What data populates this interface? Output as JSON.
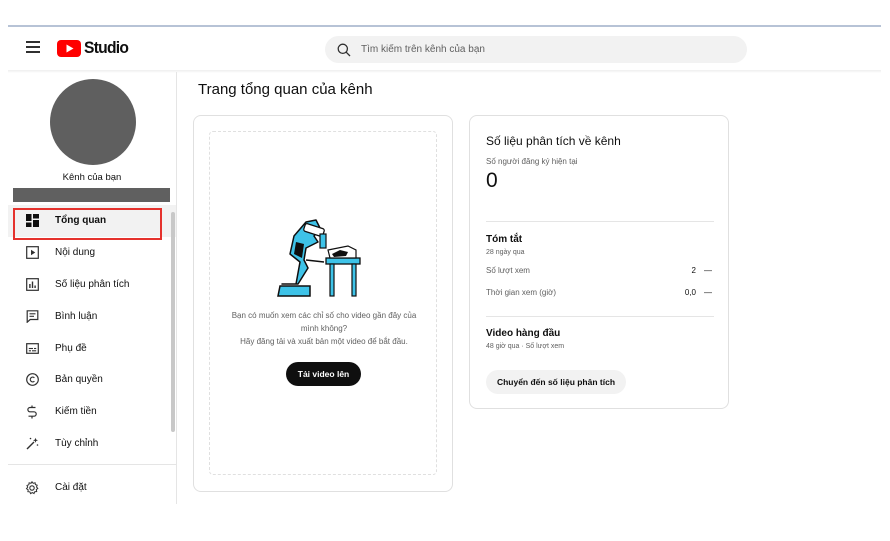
{
  "app": {
    "name": "Studio",
    "brand_color": "#ff0000"
  },
  "search": {
    "placeholder": "Tìm kiếm trên kênh của bạn",
    "icon": "search-icon"
  },
  "channel": {
    "label": "Kênh của bạn"
  },
  "sidebar": {
    "items": [
      {
        "label": "Tổng quan",
        "icon": "dashboard-icon",
        "active": true
      },
      {
        "label": "Nội dung",
        "icon": "content-icon"
      },
      {
        "label": "Số liệu phân tích",
        "icon": "analytics-icon"
      },
      {
        "label": "Bình luận",
        "icon": "comments-icon"
      },
      {
        "label": "Phụ đề",
        "icon": "subtitles-icon"
      },
      {
        "label": "Bản quyền",
        "icon": "copyright-icon"
      },
      {
        "label": "Kiếm tiền",
        "icon": "monetization-icon"
      },
      {
        "label": "Tùy chỉnh",
        "icon": "customization-icon"
      }
    ],
    "settings": {
      "label": "Cài đặt",
      "icon": "gear-icon"
    }
  },
  "page": {
    "title": "Trang tổng quan của kênh"
  },
  "upload_card": {
    "prompt_line1": "Bạn có muốn xem các chỉ số cho video gần đây của",
    "prompt_line2": "mình không?",
    "prompt_line3": "Hãy đăng tải và xuất bản một video để bắt đầu.",
    "button": "Tải video lên"
  },
  "analytics_card": {
    "title": "Số liệu phân tích về kênh",
    "subscribers_label": "Số người đăng ký hiện tại",
    "subscribers_value": "0",
    "summary_title": "Tóm tắt",
    "summary_period": "28 ngày qua",
    "metrics": [
      {
        "label": "Số lượt xem",
        "value": "2",
        "trend": "—"
      },
      {
        "label": "Thời gian xem (giờ)",
        "value": "0,0",
        "trend": "—"
      }
    ],
    "top_videos_title": "Video hàng đầu",
    "top_videos_sub": "48 giờ qua · Số lượt xem",
    "button": "Chuyển đến số liệu phân tích"
  },
  "colors": {
    "active_outline": "#e5322d",
    "avatar": "#5f5f5f",
    "illustration": "#3ec3e8"
  }
}
